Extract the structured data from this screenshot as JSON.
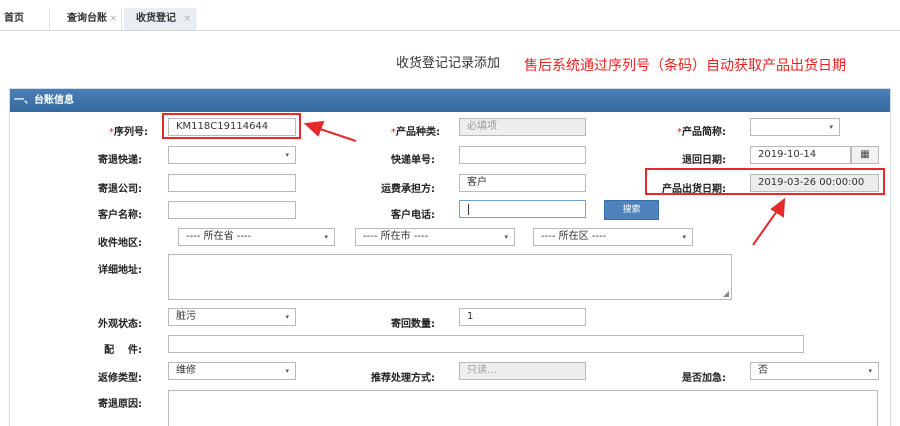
{
  "tabs": [
    {
      "label": "首页"
    },
    {
      "label": "查询台账",
      "close": "×"
    },
    {
      "label": "收货登记",
      "close": "×"
    }
  ],
  "page_title": "收货登记记录添加",
  "annotation": "售后系统通过序列号（条码）自动获取产品出货日期",
  "section_title": "一、台账信息",
  "required_mark": "*",
  "fields": {
    "serial": {
      "label": "序列号:",
      "value": "KM118C19114644"
    },
    "product_type": {
      "label": "产品种类:",
      "placeholder": "必填项"
    },
    "product_brand": {
      "label": "产品简称:"
    },
    "return_courier": {
      "label": "寄退快递:"
    },
    "tracking_no": {
      "label": "快递单号:"
    },
    "return_date": {
      "label": "退回日期:",
      "value": "2019-10-14"
    },
    "return_company": {
      "label": "寄退公司:"
    },
    "freight_payer": {
      "label": "运费承担方:",
      "value": "客户"
    },
    "ship_date": {
      "label": "产品出货日期:",
      "value": "2019-03-26 00:00:00"
    },
    "customer_name": {
      "label": "客户名称:"
    },
    "customer_phone": {
      "label": "客户电话:"
    },
    "search": {
      "label": "搜索"
    },
    "region": {
      "label": "收件地区:",
      "province": "---- 所在省 ----",
      "city": "---- 所在市 ----",
      "district": "---- 所在区 ----"
    },
    "address": {
      "label": "详细地址:"
    },
    "appearance": {
      "label": "外观状态:",
      "value": "脏污"
    },
    "quantity": {
      "label": "寄回数量:",
      "value": "1"
    },
    "accessories": {
      "label": "配    件:"
    },
    "repair_type": {
      "label": "返修类型:",
      "value": "维修"
    },
    "recommend": {
      "label": "推荐处理方式:",
      "placeholder": "只读..."
    },
    "urgent": {
      "label": "是否加急:",
      "value": "否"
    },
    "return_reason": {
      "label": "寄退原因:"
    }
  },
  "icons": {
    "dropdown": "▾",
    "calendar": "▦",
    "resize": "◢"
  },
  "colors": {
    "accent": "#3a6fa6",
    "highlight": "#e52a2a"
  }
}
